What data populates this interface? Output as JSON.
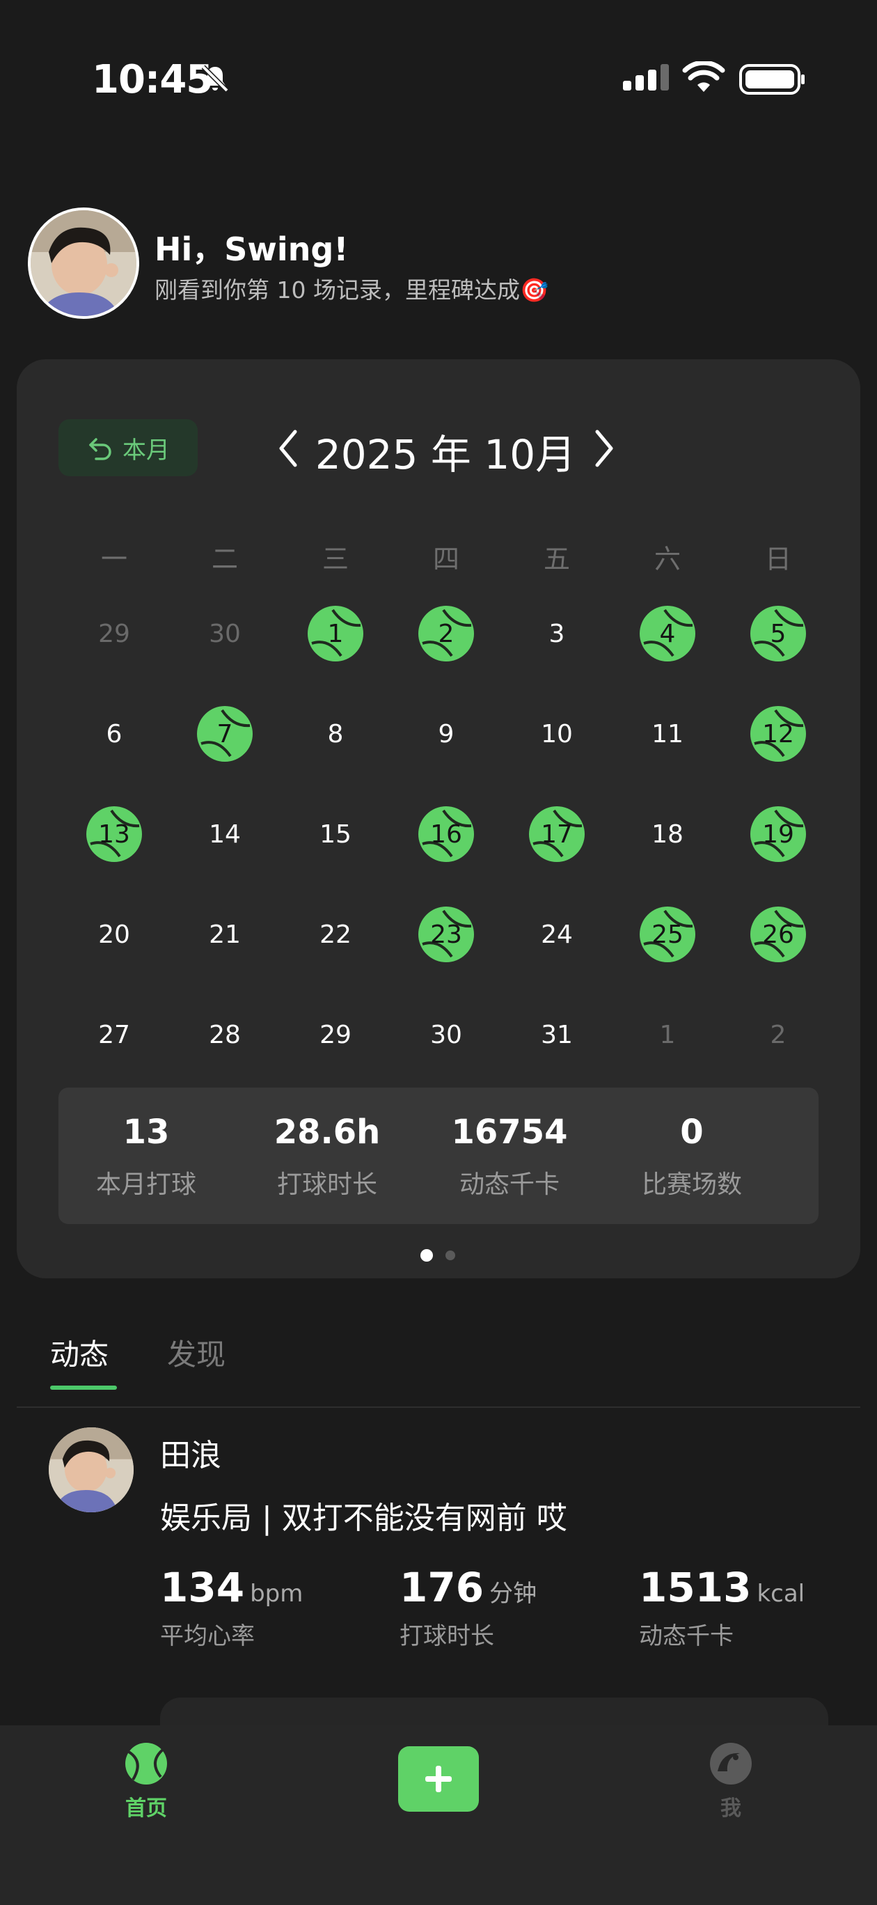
{
  "status_bar": {
    "time": "10:45"
  },
  "greeting": {
    "title": "Hi，Swing!",
    "subtitle": "刚看到你第 10 场记录，里程碑达成🎯"
  },
  "calendar": {
    "this_month_label": "本月",
    "month_title": "2025 年 10月",
    "weekdays": [
      "一",
      "二",
      "三",
      "四",
      "五",
      "六",
      "日"
    ],
    "weeks": [
      [
        {
          "d": "29",
          "dim": true
        },
        {
          "d": "30",
          "dim": true
        },
        {
          "d": "1",
          "played": true
        },
        {
          "d": "2",
          "played": true
        },
        {
          "d": "3"
        },
        {
          "d": "4",
          "played": true
        },
        {
          "d": "5",
          "played": true
        }
      ],
      [
        {
          "d": "6"
        },
        {
          "d": "7",
          "played": true
        },
        {
          "d": "8"
        },
        {
          "d": "9"
        },
        {
          "d": "10"
        },
        {
          "d": "11"
        },
        {
          "d": "12",
          "played": true
        }
      ],
      [
        {
          "d": "13",
          "played": true
        },
        {
          "d": "14"
        },
        {
          "d": "15"
        },
        {
          "d": "16",
          "played": true
        },
        {
          "d": "17",
          "played": true
        },
        {
          "d": "18"
        },
        {
          "d": "19",
          "played": true
        }
      ],
      [
        {
          "d": "20"
        },
        {
          "d": "21"
        },
        {
          "d": "22"
        },
        {
          "d": "23",
          "played": true
        },
        {
          "d": "24"
        },
        {
          "d": "25",
          "played": true
        },
        {
          "d": "26",
          "played": true
        }
      ],
      [
        {
          "d": "27"
        },
        {
          "d": "28"
        },
        {
          "d": "29"
        },
        {
          "d": "30"
        },
        {
          "d": "31"
        },
        {
          "d": "1",
          "dim": true
        },
        {
          "d": "2",
          "dim": true
        }
      ]
    ],
    "stats": [
      {
        "value": "13",
        "label": "本月打球"
      },
      {
        "value": "28.6h",
        "label": "打球时长"
      },
      {
        "value": "16754",
        "label": "动态千卡"
      },
      {
        "value": "0",
        "label": "比赛场数"
      }
    ],
    "page_indicator": {
      "active": 0,
      "count": 2
    }
  },
  "tabs": {
    "active": "动态",
    "inactive": "发现"
  },
  "feed": {
    "name": "田浪",
    "text": "娱乐局 | 双打不能没有网前 哎",
    "stats": [
      {
        "value": "134",
        "unit": "bpm",
        "label": "平均心率"
      },
      {
        "value": "176",
        "unit": "分钟",
        "label": "打球时长"
      },
      {
        "value": "1513",
        "unit": "kcal",
        "label": "动态千卡"
      }
    ]
  },
  "bottom_nav": {
    "home_label": "首页",
    "me_label": "我"
  },
  "colors": {
    "accent": "#5fd267",
    "background": "#1b1b1b",
    "card": "#2a2a2a"
  }
}
